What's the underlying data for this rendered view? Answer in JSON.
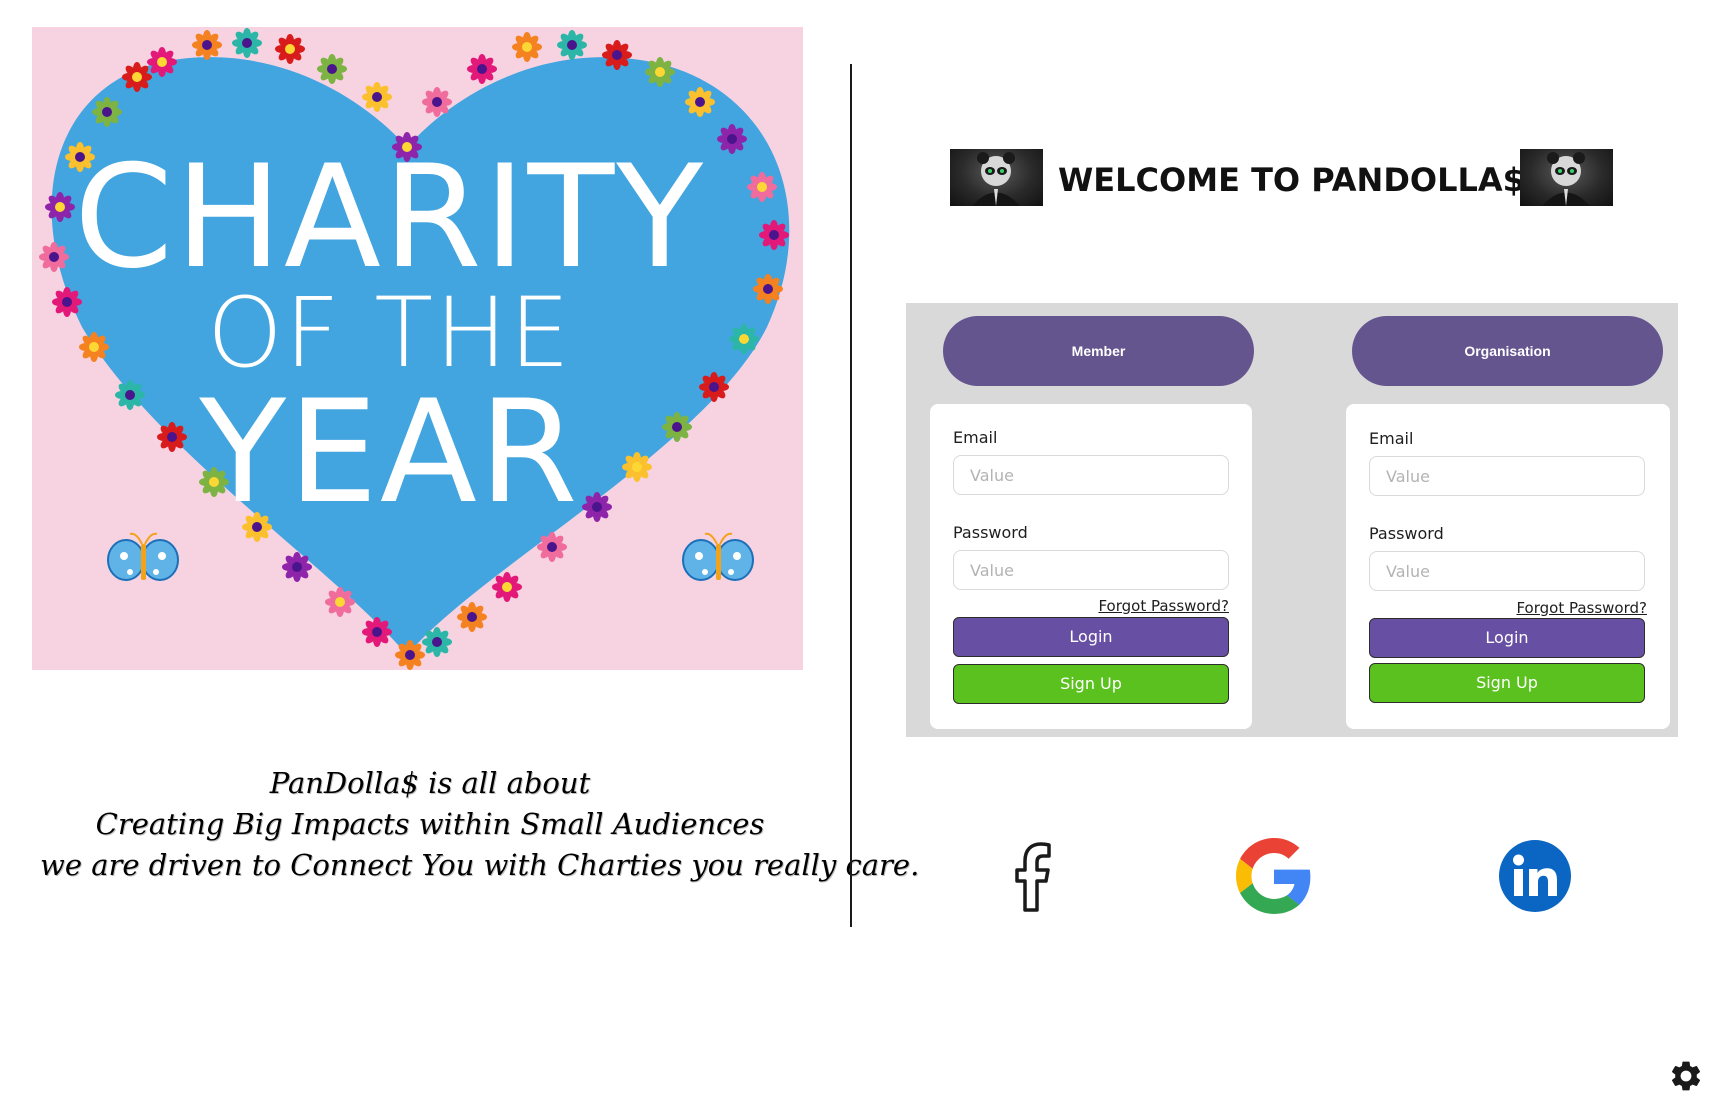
{
  "hero": {
    "line1": "CHARITY",
    "line2": "OF THE",
    "line3": "YEAR"
  },
  "tagline": {
    "line1": "PanDolla$ is all about",
    "line2": "Creating Big Impacts within Small Audiences",
    "line3": "we are driven to Connect You with Charties you really care."
  },
  "header": {
    "welcome": "WELCOME TO PANDOLLA$"
  },
  "member": {
    "tab_label": "Member",
    "email_label": "Email",
    "email_placeholder": "Value",
    "password_label": "Password",
    "password_placeholder": "Value",
    "forgot_label": "Forgot Password?",
    "login_label": "Login",
    "signup_label": "Sign Up"
  },
  "organisation": {
    "tab_label": "Organisation",
    "email_label": "Email",
    "email_placeholder": "Value",
    "password_label": "Password",
    "password_placeholder": "Value",
    "forgot_label": "Forgot Password?",
    "login_label": "Login",
    "signup_label": "Sign Up"
  },
  "social": {
    "icons": [
      "facebook-icon",
      "google-icon",
      "linkedin-icon"
    ]
  },
  "colors": {
    "tab_purple": "#65558f",
    "login_purple": "#6750a4",
    "signup_green": "#5bc11f",
    "panel_gray": "#d9d9d9",
    "hero_pink": "#f7d3e2",
    "heart_blue": "#42a5df",
    "linkedin_blue": "#0a66c2"
  }
}
